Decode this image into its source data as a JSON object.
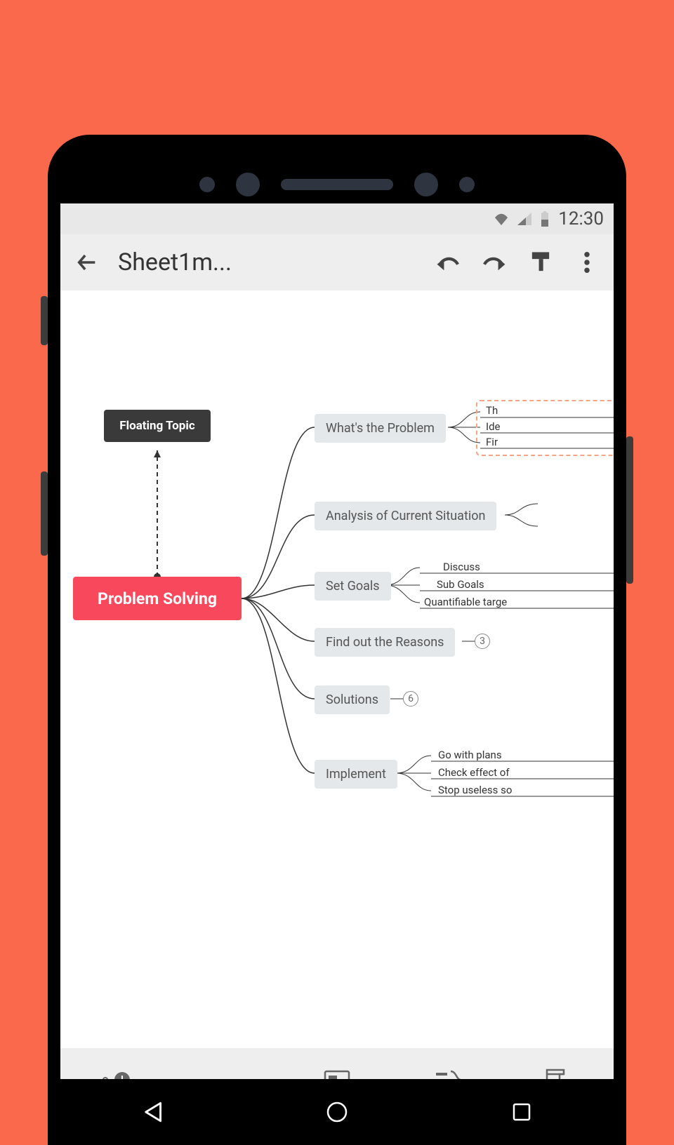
{
  "status": {
    "time": "12:30"
  },
  "appbar": {
    "title": "Sheet1m..."
  },
  "mindmap": {
    "root": "Problem Solving",
    "floating": "Floating Topic",
    "children": [
      {
        "label": "What's the Problem",
        "subs": [
          "Th",
          "Ide",
          "Fir"
        ],
        "selected_sub_group": true
      },
      {
        "label": "Analysis of Current Situation"
      },
      {
        "label": "Set Goals",
        "subs": [
          "Discuss",
          "Sub Goals",
          "Quantifiable targe"
        ]
      },
      {
        "label": "Find out the Reasons",
        "count": "3"
      },
      {
        "label": "Solutions",
        "count": "6"
      },
      {
        "label": "Implement",
        "subs": [
          "Go with plans",
          "Check effect of",
          "Stop useless so"
        ]
      }
    ]
  }
}
